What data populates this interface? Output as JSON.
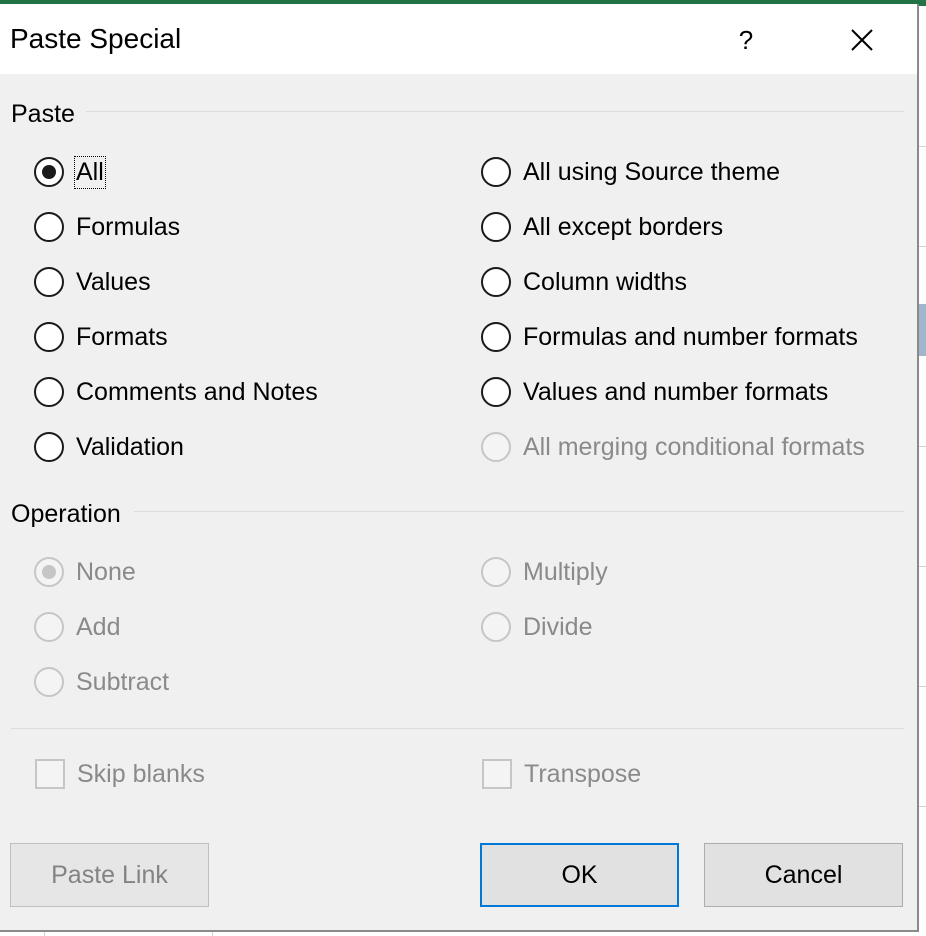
{
  "dialog": {
    "title": "Paste Special",
    "help_label": "?"
  },
  "paste": {
    "label": "Paste",
    "options": [
      {
        "label": "All",
        "selected": true,
        "enabled": true
      },
      {
        "label": "Formulas",
        "selected": false,
        "enabled": true
      },
      {
        "label": "Values",
        "selected": false,
        "enabled": true
      },
      {
        "label": "Formats",
        "selected": false,
        "enabled": true
      },
      {
        "label": "Comments and Notes",
        "selected": false,
        "enabled": true
      },
      {
        "label": "Validation",
        "selected": false,
        "enabled": true
      },
      {
        "label": "All using Source theme",
        "selected": false,
        "enabled": true
      },
      {
        "label": "All except borders",
        "selected": false,
        "enabled": true
      },
      {
        "label": "Column widths",
        "selected": false,
        "enabled": true
      },
      {
        "label": "Formulas and number formats",
        "selected": false,
        "enabled": true
      },
      {
        "label": "Values and number formats",
        "selected": false,
        "enabled": true
      },
      {
        "label": "All merging conditional formats",
        "selected": false,
        "enabled": false
      }
    ]
  },
  "operation": {
    "label": "Operation",
    "options": [
      {
        "label": "None",
        "selected": true,
        "enabled": false
      },
      {
        "label": "Add",
        "selected": false,
        "enabled": false
      },
      {
        "label": "Subtract",
        "selected": false,
        "enabled": false
      },
      {
        "label": "Multiply",
        "selected": false,
        "enabled": false
      },
      {
        "label": "Divide",
        "selected": false,
        "enabled": false
      }
    ]
  },
  "checkboxes": {
    "skip_blanks": {
      "label": "Skip blanks",
      "checked": false,
      "enabled": false
    },
    "transpose": {
      "label": "Transpose",
      "checked": false,
      "enabled": false
    }
  },
  "buttons": {
    "paste_link": "Paste Link",
    "ok": "OK",
    "cancel": "Cancel"
  },
  "colors": {
    "excel_green": "#217346",
    "default_button_border": "#0078d7",
    "disabled_text": "#8a8a8a"
  }
}
